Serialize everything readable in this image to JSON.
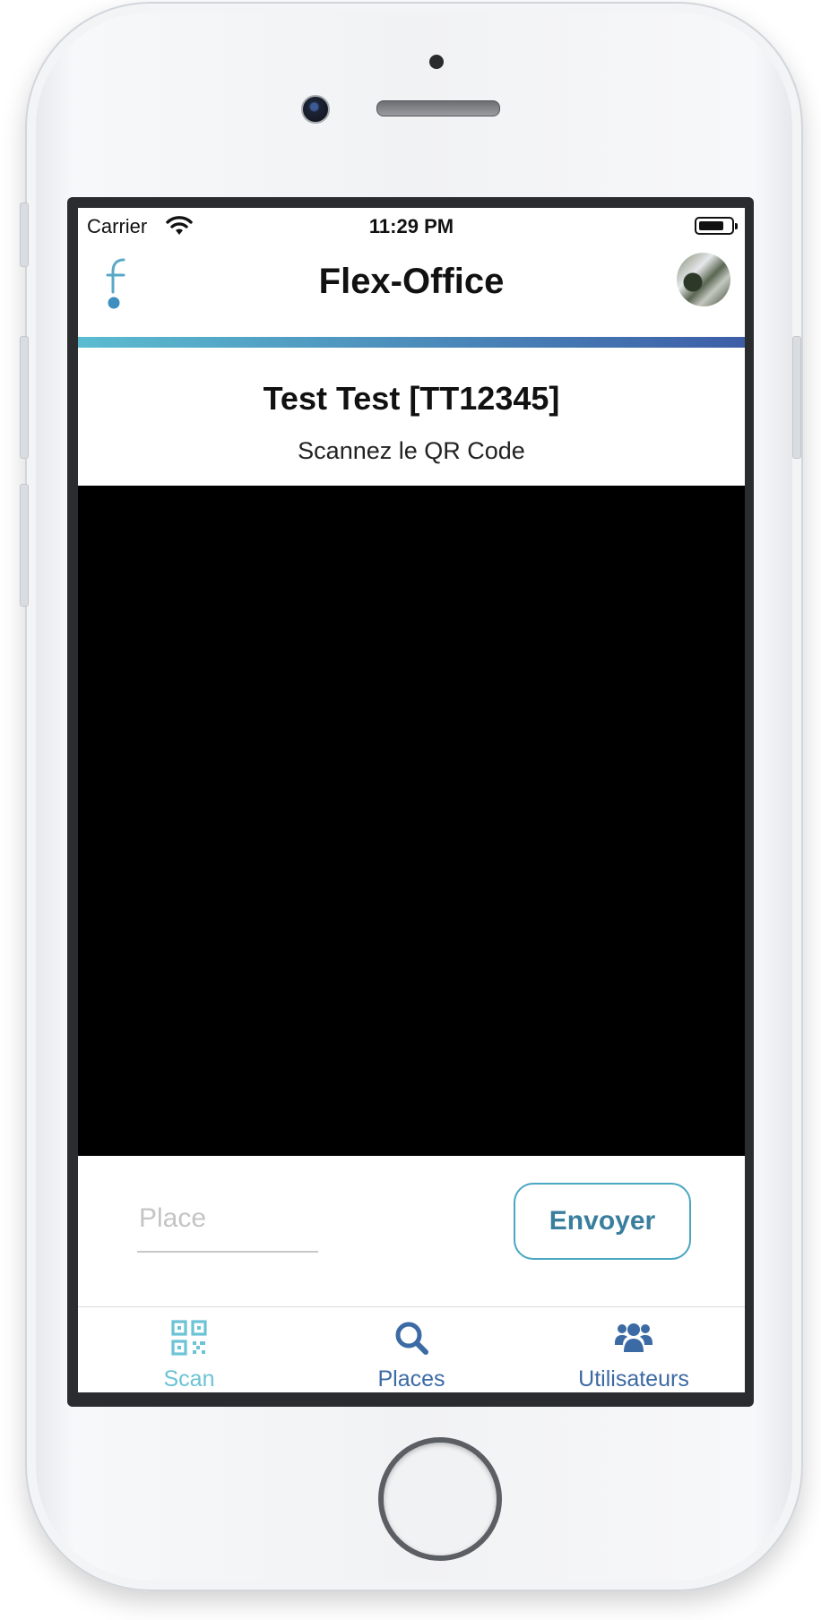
{
  "status_bar": {
    "carrier": "Carrier",
    "time": "11:29 PM",
    "battery_level": 0.8
  },
  "nav": {
    "title": "Flex-Office",
    "logo_icon": "flex-office-logo",
    "avatar_icon": "user-avatar"
  },
  "header": {
    "user_title": "Test Test [TT12345]",
    "instruction": "Scannez le QR Code"
  },
  "form": {
    "place_placeholder": "Place",
    "place_value": "",
    "send_label": "Envoyer"
  },
  "tabs": [
    {
      "label": "Scan",
      "icon": "qr-code-icon",
      "active": true
    },
    {
      "label": "Places",
      "icon": "search-icon",
      "active": false
    },
    {
      "label": "Utilisateurs",
      "icon": "users-icon",
      "active": false
    }
  ],
  "colors": {
    "accent_start": "#5bbcd0",
    "accent_end": "#3d5ea7",
    "tab_active": "#6cc3d5",
    "tab_inactive": "#3c6aa4",
    "scanner_background": "#000000"
  }
}
